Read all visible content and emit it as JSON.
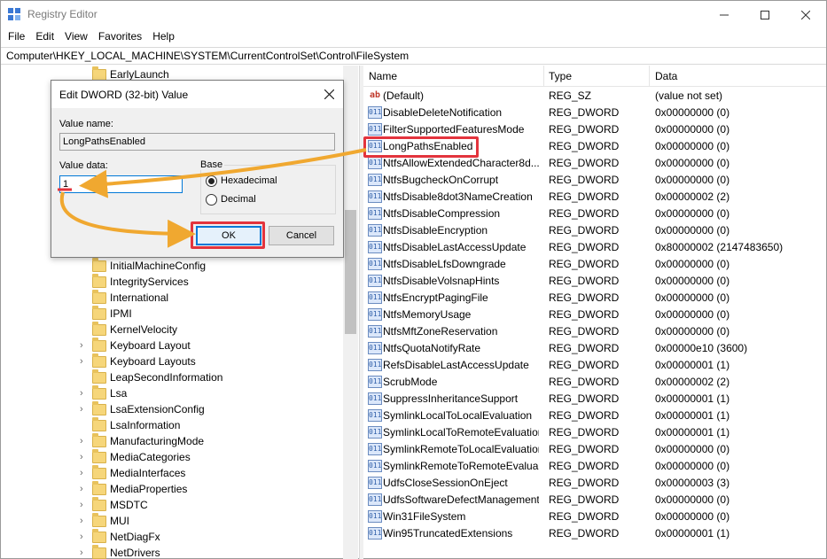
{
  "window": {
    "title": "Registry Editor"
  },
  "menu": [
    "File",
    "Edit",
    "View",
    "Favorites",
    "Help"
  ],
  "address": "Computer\\HKEY_LOCAL_MACHINE\\SYSTEM\\CurrentControlSet\\Control\\FileSystem",
  "tree": {
    "items": [
      {
        "label": "EarlyLaunch",
        "expandable": false
      },
      {
        "label": "InitialMachineConfig",
        "expandable": false
      },
      {
        "label": "IntegrityServices",
        "expandable": false
      },
      {
        "label": "International",
        "expandable": false
      },
      {
        "label": "IPMI",
        "expandable": false
      },
      {
        "label": "KernelVelocity",
        "expandable": false
      },
      {
        "label": "Keyboard Layout",
        "expandable": true
      },
      {
        "label": "Keyboard Layouts",
        "expandable": true
      },
      {
        "label": "LeapSecondInformation",
        "expandable": false
      },
      {
        "label": "Lsa",
        "expandable": true
      },
      {
        "label": "LsaExtensionConfig",
        "expandable": true
      },
      {
        "label": "LsaInformation",
        "expandable": false
      },
      {
        "label": "ManufacturingMode",
        "expandable": true
      },
      {
        "label": "MediaCategories",
        "expandable": true
      },
      {
        "label": "MediaInterfaces",
        "expandable": true
      },
      {
        "label": "MediaProperties",
        "expandable": true
      },
      {
        "label": "MSDTC",
        "expandable": true
      },
      {
        "label": "MUI",
        "expandable": true
      },
      {
        "label": "NetDiagFx",
        "expandable": true
      },
      {
        "label": "NetDrivers",
        "expandable": true
      }
    ]
  },
  "list": {
    "headers": {
      "name": "Name",
      "type": "Type",
      "data": "Data"
    },
    "rows": [
      {
        "name": "(Default)",
        "type": "REG_SZ",
        "data": "(value not set)",
        "icon": "ab"
      },
      {
        "name": "DisableDeleteNotification",
        "type": "REG_DWORD",
        "data": "0x00000000 (0)",
        "icon": "bin"
      },
      {
        "name": "FilterSupportedFeaturesMode",
        "type": "REG_DWORD",
        "data": "0x00000000 (0)",
        "icon": "bin"
      },
      {
        "name": "LongPathsEnabled",
        "type": "REG_DWORD",
        "data": "0x00000000 (0)",
        "icon": "bin"
      },
      {
        "name": "NtfsAllowExtendedCharacter8d...",
        "type": "REG_DWORD",
        "data": "0x00000000 (0)",
        "icon": "bin"
      },
      {
        "name": "NtfsBugcheckOnCorrupt",
        "type": "REG_DWORD",
        "data": "0x00000000 (0)",
        "icon": "bin"
      },
      {
        "name": "NtfsDisable8dot3NameCreation",
        "type": "REG_DWORD",
        "data": "0x00000002 (2)",
        "icon": "bin"
      },
      {
        "name": "NtfsDisableCompression",
        "type": "REG_DWORD",
        "data": "0x00000000 (0)",
        "icon": "bin"
      },
      {
        "name": "NtfsDisableEncryption",
        "type": "REG_DWORD",
        "data": "0x00000000 (0)",
        "icon": "bin"
      },
      {
        "name": "NtfsDisableLastAccessUpdate",
        "type": "REG_DWORD",
        "data": "0x80000002 (2147483650)",
        "icon": "bin"
      },
      {
        "name": "NtfsDisableLfsDowngrade",
        "type": "REG_DWORD",
        "data": "0x00000000 (0)",
        "icon": "bin"
      },
      {
        "name": "NtfsDisableVolsnapHints",
        "type": "REG_DWORD",
        "data": "0x00000000 (0)",
        "icon": "bin"
      },
      {
        "name": "NtfsEncryptPagingFile",
        "type": "REG_DWORD",
        "data": "0x00000000 (0)",
        "icon": "bin"
      },
      {
        "name": "NtfsMemoryUsage",
        "type": "REG_DWORD",
        "data": "0x00000000 (0)",
        "icon": "bin"
      },
      {
        "name": "NtfsMftZoneReservation",
        "type": "REG_DWORD",
        "data": "0x00000000 (0)",
        "icon": "bin"
      },
      {
        "name": "NtfsQuotaNotifyRate",
        "type": "REG_DWORD",
        "data": "0x00000e10 (3600)",
        "icon": "bin"
      },
      {
        "name": "RefsDisableLastAccessUpdate",
        "type": "REG_DWORD",
        "data": "0x00000001 (1)",
        "icon": "bin"
      },
      {
        "name": "ScrubMode",
        "type": "REG_DWORD",
        "data": "0x00000002 (2)",
        "icon": "bin"
      },
      {
        "name": "SuppressInheritanceSupport",
        "type": "REG_DWORD",
        "data": "0x00000001 (1)",
        "icon": "bin"
      },
      {
        "name": "SymlinkLocalToLocalEvaluation",
        "type": "REG_DWORD",
        "data": "0x00000001 (1)",
        "icon": "bin"
      },
      {
        "name": "SymlinkLocalToRemoteEvaluation",
        "type": "REG_DWORD",
        "data": "0x00000001 (1)",
        "icon": "bin"
      },
      {
        "name": "SymlinkRemoteToLocalEvaluation",
        "type": "REG_DWORD",
        "data": "0x00000000 (0)",
        "icon": "bin"
      },
      {
        "name": "SymlinkRemoteToRemoteEvalua...",
        "type": "REG_DWORD",
        "data": "0x00000000 (0)",
        "icon": "bin"
      },
      {
        "name": "UdfsCloseSessionOnEject",
        "type": "REG_DWORD",
        "data": "0x00000003 (3)",
        "icon": "bin"
      },
      {
        "name": "UdfsSoftwareDefectManagement",
        "type": "REG_DWORD",
        "data": "0x00000000 (0)",
        "icon": "bin"
      },
      {
        "name": "Win31FileSystem",
        "type": "REG_DWORD",
        "data": "0x00000000 (0)",
        "icon": "bin"
      },
      {
        "name": "Win95TruncatedExtensions",
        "type": "REG_DWORD",
        "data": "0x00000001 (1)",
        "icon": "bin"
      }
    ]
  },
  "dialog": {
    "title": "Edit DWORD (32-bit) Value",
    "value_name_label": "Value name:",
    "value_name": "LongPathsEnabled",
    "value_data_label": "Value data:",
    "value_data": "1",
    "base_label": "Base",
    "base_hex": "Hexadecimal",
    "base_dec": "Decimal",
    "base_selected": "Hexadecimal",
    "ok": "OK",
    "cancel": "Cancel"
  },
  "colors": {
    "highlight": "#e3343d",
    "arrow": "#f0a830",
    "folder": "#f6d67a",
    "accent": "#0078d7"
  }
}
